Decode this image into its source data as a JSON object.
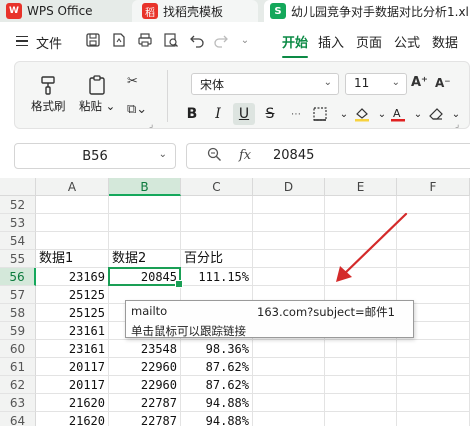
{
  "tabs": [
    {
      "label": "WPS Office",
      "icon": "wps-logo-icon"
    },
    {
      "label": "找稻壳模板",
      "icon": "docer-icon"
    },
    {
      "label": "幼儿园竞争对手数据对比分析1.xl",
      "icon": "spreadsheet-icon"
    }
  ],
  "menu": {
    "file_label": "文件",
    "tabs": [
      "开始",
      "插入",
      "页面",
      "公式",
      "数据"
    ],
    "active_tab": "开始"
  },
  "ribbon": {
    "format_painter": "格式刷",
    "paste": "粘贴",
    "font_name": "宋体",
    "font_size": "11"
  },
  "formula_bar": {
    "cell_ref": "B56",
    "fx_label": "fx",
    "value": "20845"
  },
  "grid": {
    "columns": [
      "A",
      "B",
      "C",
      "D",
      "E",
      "F"
    ],
    "selected_column": "B",
    "rows": [
      {
        "num": "52",
        "cells": [
          "",
          "",
          ""
        ]
      },
      {
        "num": "53",
        "cells": [
          "",
          "",
          ""
        ]
      },
      {
        "num": "54",
        "cells": [
          "",
          "",
          ""
        ]
      },
      {
        "num": "55",
        "cells": [
          "数据1",
          "数据2",
          "百分比"
        ]
      },
      {
        "num": "56",
        "cells": [
          "23169",
          "20845",
          "111.15%"
        ]
      },
      {
        "num": "57",
        "cells": [
          "25125",
          "",
          ""
        ]
      },
      {
        "num": "58",
        "cells": [
          "25125",
          "",
          ""
        ]
      },
      {
        "num": "59",
        "cells": [
          "23161",
          "",
          ""
        ]
      },
      {
        "num": "60",
        "cells": [
          "23161",
          "23548",
          "98.36%"
        ]
      },
      {
        "num": "61",
        "cells": [
          "20117",
          "22960",
          "87.62%"
        ]
      },
      {
        "num": "62",
        "cells": [
          "20117",
          "22960",
          "87.62%"
        ]
      },
      {
        "num": "63",
        "cells": [
          "21620",
          "22787",
          "94.88%"
        ]
      },
      {
        "num": "64",
        "cells": [
          "21620",
          "22787",
          "94.88%"
        ]
      }
    ]
  },
  "tooltip": {
    "line1_left": "mailto",
    "line1_right": "163.com?subject=邮件1",
    "line2": "单击鼠标可以跟踪链接"
  },
  "colors": {
    "accent": "#0c8a45",
    "active_cell_border": "#1a9f55",
    "arrow": "#d42a2a"
  }
}
